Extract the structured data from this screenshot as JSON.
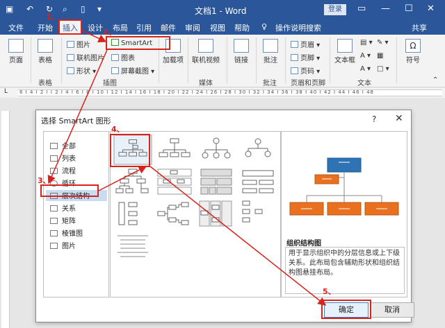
{
  "titlebar": {
    "doc_title": "文档1 - Word",
    "login": "登录",
    "qa_save_icon": "save-icon",
    "qa_undo_icon": "undo-icon",
    "qa_redo_icon": "redo-icon",
    "qa_preview_icon": "print-preview-icon",
    "qa_new_icon": "new-doc-icon",
    "qa_more": "▾"
  },
  "tabs": [
    "文件",
    "开始",
    "插入",
    "设计",
    "布局",
    "引用",
    "邮件",
    "审阅",
    "视图",
    "帮助"
  ],
  "tell_me": "操作说明搜索",
  "share": "共享",
  "ribbon": {
    "pages": "页面",
    "table": "表格",
    "table_group": "表格",
    "picture": "图片",
    "online_picture": "联机图片",
    "shapes": "形状",
    "smartart": "SmartArt",
    "chart": "图表",
    "screenshot": "屏幕截图",
    "illustrations_group": "插图",
    "addins": "加载项",
    "online_video": "联机视频",
    "media_group": "媒体",
    "link": "链接",
    "comment": "批注",
    "comment_group": "批注",
    "header": "页眉",
    "footer": "页脚",
    "page_number": "页码",
    "header_footer_group": "页眉和页脚",
    "textbox": "文本框",
    "text_group": "文本",
    "symbol": "符号"
  },
  "ruler_text": "6 I 4 I 2 I I 2 I 4 I 6 I 8 I 10 I 12 I 14 I 16 I 18 I 20 I 22 I 24 I 26 I 28 I 30 I 32 I 34 I 36 I 38 I 40 I 42 I 44 I 46 I 48",
  "dialog": {
    "title": "选择 SmartArt 图形",
    "help": "?",
    "close": "✕",
    "categories": [
      "全部",
      "列表",
      "流程",
      "循环",
      "层次结构",
      "关系",
      "矩阵",
      "棱锥图",
      "图片"
    ],
    "selected_category": "层次结构",
    "preview_title": "组织结构图",
    "preview_description": "用于显示组织中的分层信息或上下级关系。此布局包含辅助形状和组织结构图悬挂布局。",
    "ok": "确定",
    "cancel": "取消"
  },
  "annotations": [
    "1、",
    "2、",
    "3、",
    "4、",
    "5、"
  ],
  "colors": {
    "word_blue": "#2b579a",
    "annotation_red": "#d8231d",
    "preview_blue": "#2e74b5",
    "preview_orange": "#e8701f"
  }
}
